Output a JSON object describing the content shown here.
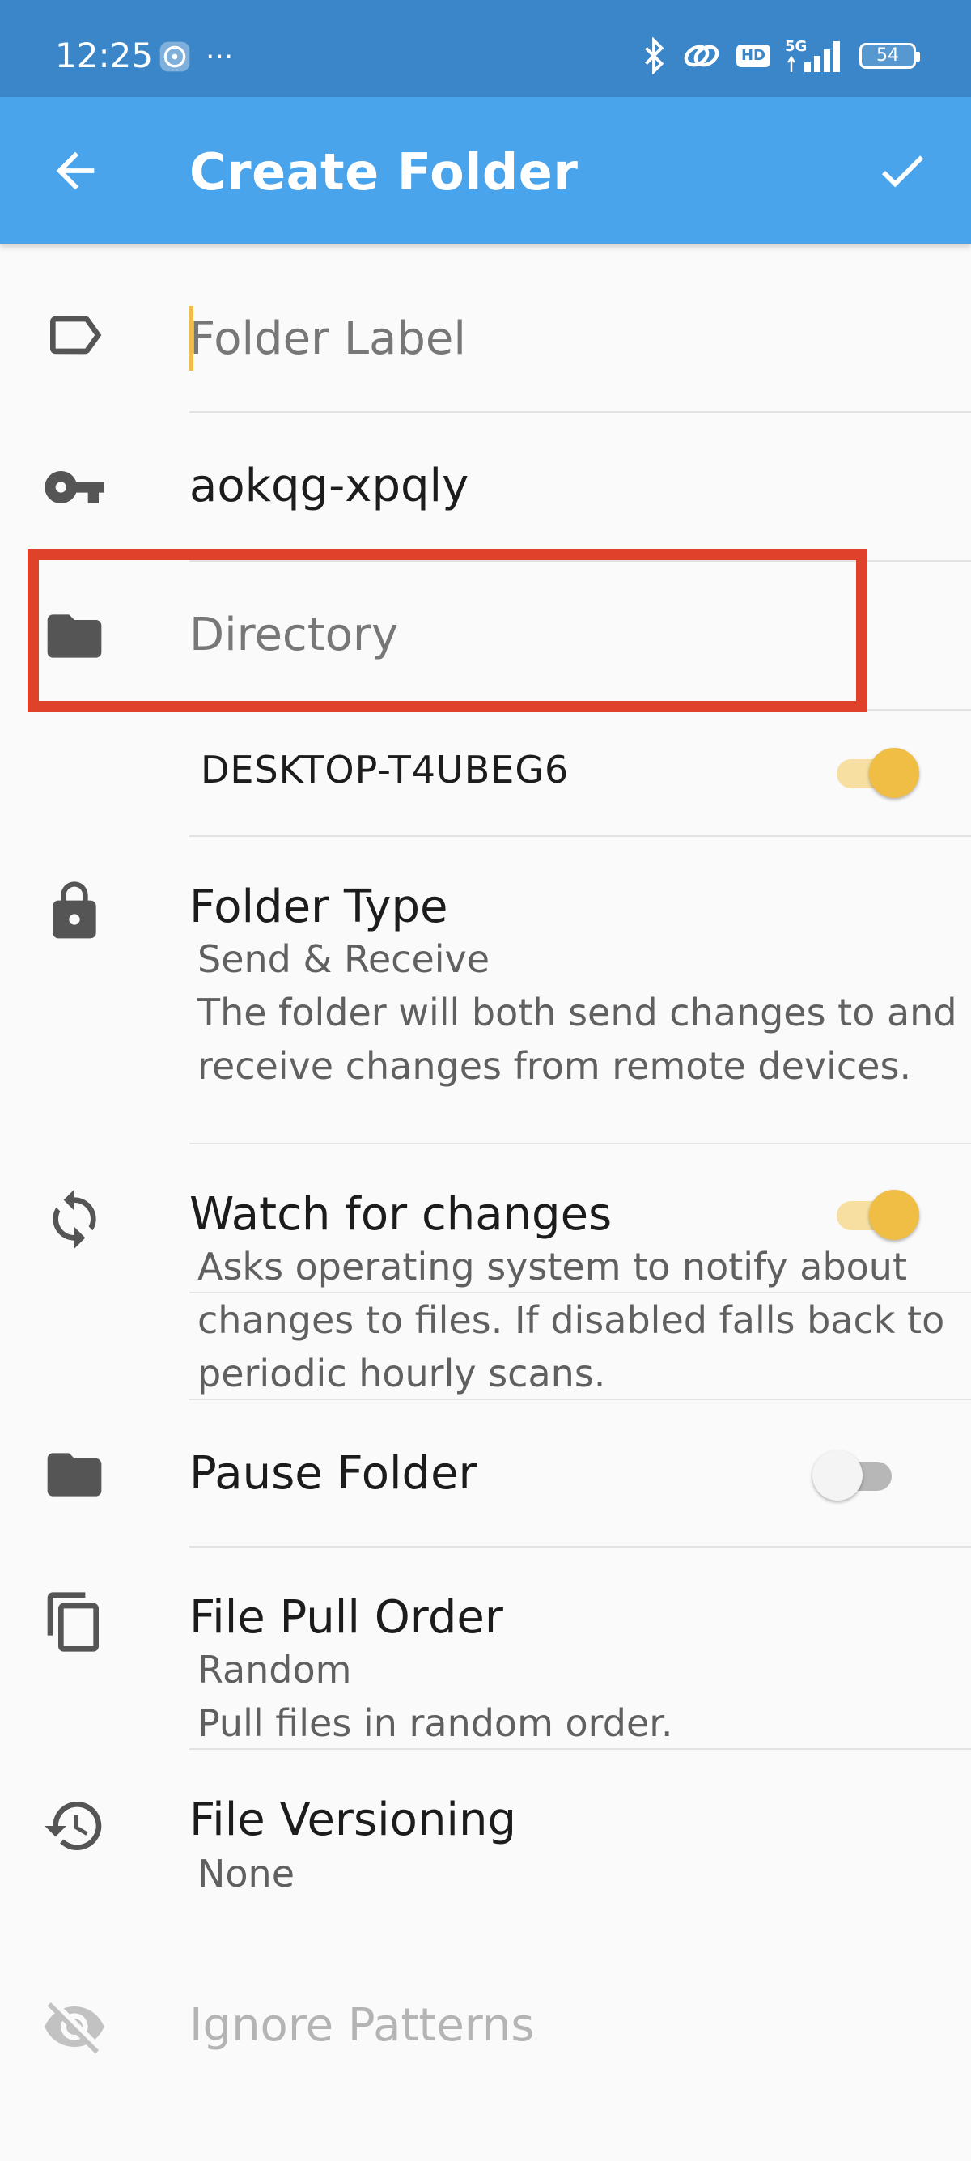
{
  "status_bar": {
    "time": "12:25",
    "more": "···",
    "battery": "54",
    "hd": "HD",
    "network": "5G"
  },
  "toolbar": {
    "title": "Create Folder"
  },
  "form": {
    "label_placeholder": "Folder Label",
    "folder_id": "aokqg-xpqly",
    "directory_placeholder": "Directory"
  },
  "device": {
    "name": "DESKTOP-T4UBEG6",
    "shared": true
  },
  "folder_type": {
    "title": "Folder Type",
    "value": "Send & Receive",
    "desc_line1": "The folder will both send changes to and",
    "desc_line2": "receive changes from remote devices."
  },
  "watch": {
    "title": "Watch for changes",
    "enabled": true,
    "desc_line1": "Asks operating system to notify about",
    "desc_line2": "changes to files. If disabled falls back to",
    "desc_line3": "periodic hourly scans."
  },
  "pause": {
    "title": "Pause Folder",
    "enabled": false
  },
  "pull_order": {
    "title": "File Pull Order",
    "value": "Random",
    "desc": "Pull files in random order."
  },
  "versioning": {
    "title": "File Versioning",
    "value": "None"
  },
  "ignore": {
    "title": "Ignore Patterns"
  },
  "colors": {
    "toolbar": "#4aa4ec",
    "status_bar": "#3a86c8",
    "accent": "#f0bd45",
    "highlight": "#e0412a"
  },
  "icons": [
    "back-arrow-icon",
    "check-icon",
    "label-icon",
    "key-icon",
    "folder-icon",
    "lock-icon",
    "sync-icon",
    "copy-icon",
    "history-icon",
    "eye-off-icon"
  ]
}
